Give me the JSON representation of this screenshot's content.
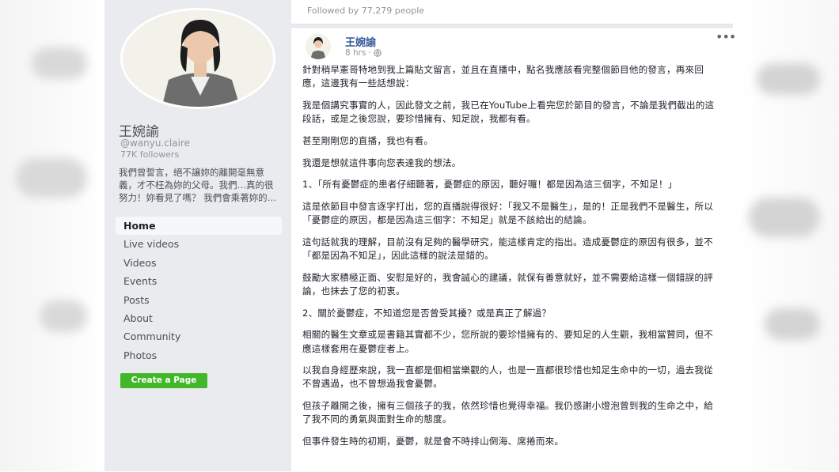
{
  "profile": {
    "name": "王婉諭",
    "handle": "@wanyu.claire",
    "followers": "77K followers",
    "bio": "我們曾誓言，絕不讓妳的離開毫無意義，才不枉為妳的父母。我們…真的很努力！妳看見了嗎？ 我們會乘著妳的…"
  },
  "nav": {
    "items": [
      {
        "label": "Home"
      },
      {
        "label": "Live videos"
      },
      {
        "label": "Videos"
      },
      {
        "label": "Events"
      },
      {
        "label": "Posts"
      },
      {
        "label": "About"
      },
      {
        "label": "Community"
      },
      {
        "label": "Photos"
      }
    ],
    "create_page": "Create a Page"
  },
  "feed": {
    "followed_by": "Followed by 77,279 people",
    "post": {
      "author": "王婉諭",
      "time": "8 hrs",
      "dot": "·",
      "more": "•••",
      "paragraphs": [
        "針對稍早憲哥特地到我上篇貼文留言，並且在直播中，點名我應該看完整個節目他的發言，再來回應，這邊我有一些話想說：",
        "我是個講究事實的人，因此發文之前，我已在YouTube上看完您於節目的發言，不論是我們截出的這段話，或是之後您說，要珍惜擁有、知足說，我都有看。",
        "甚至剛剛您的直播，我也有看。",
        "我還是想就這件事向您表達我的想法。",
        "1、「所有憂鬱症的患者仔細聽著，憂鬱症的原因，聽好囉！都是因為這三個字，不知足！」",
        "這是依節目中發言逐字打出，您的直播說得很好：「我又不是醫生」，是的！正是我們不是醫生，所以「憂鬱症的原因，都是因為這三個字：不知足」就是不該給出的結論。",
        "這句話就我的理解，目前沒有足夠的醫學研究，能這樣肯定的指出。造成憂鬱症的原因有很多，並不「都是因為不知足」，因此這樣的說法是錯的。",
        "鼓勵大家積極正面、安慰是好的，我會誠心的建議，就保有善意就好，並不需要給這樣一個錯誤的評論，也抹去了您的初衷。",
        "2、關於憂鬱症，不知道您是否曾受其擾？或是真正了解過？",
        "相關的醫生文章或是書籍其實都不少，您所說的要珍惜擁有的、要知足的人生觀，我相當贊同，但不應這樣套用在憂鬱症者上。",
        "以我自身經歷來說，我一直都是個相當樂觀的人，也是一直都很珍惜也知足生命中的一切，過去我從不曾遇過，也不曾想過我會憂鬱。",
        "但孩子離開之後，擁有三個孩子的我，依然珍惜也覺得幸福。我仍感謝小燈泡曾到我的生命之中，給了我不同的勇氣與面對生命的態度。",
        "但事件發生時的初期，憂鬱，就是會不時排山倒海、席捲而來。"
      ]
    }
  },
  "colors": {
    "sidebar_bg": "#e9ebee",
    "link_blue": "#365899",
    "create_green": "#42b72a",
    "muted_text": "#90949c"
  }
}
